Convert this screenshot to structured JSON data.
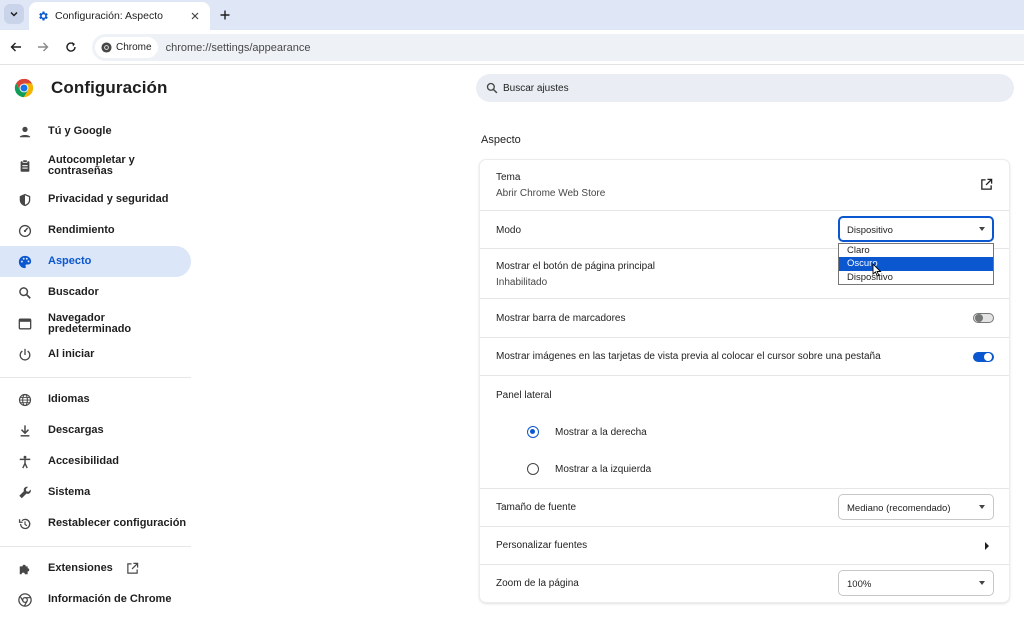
{
  "browser": {
    "tab_title": "Configuración: Aspecto",
    "chip_label": "Chrome",
    "url": "chrome://settings/appearance"
  },
  "sidebar": {
    "title": "Configuración",
    "items": [
      {
        "label": "Tú y Google",
        "icon": "person-icon"
      },
      {
        "label": "Autocompletar y contraseñas",
        "icon": "clipboard-icon"
      },
      {
        "label": "Privacidad y seguridad",
        "icon": "shield-icon"
      },
      {
        "label": "Rendimiento",
        "icon": "speedometer-icon"
      },
      {
        "label": "Aspecto",
        "icon": "palette-icon",
        "active": true
      },
      {
        "label": "Buscador",
        "icon": "search-icon"
      },
      {
        "label": "Navegador predeterminado",
        "icon": "browser-icon"
      },
      {
        "label": "Al iniciar",
        "icon": "power-icon"
      },
      {
        "label": "Idiomas",
        "icon": "globe-icon"
      },
      {
        "label": "Descargas",
        "icon": "download-icon"
      },
      {
        "label": "Accesibilidad",
        "icon": "accessibility-icon"
      },
      {
        "label": "Sistema",
        "icon": "wrench-icon"
      },
      {
        "label": "Restablecer configuración",
        "icon": "restore-icon"
      },
      {
        "label": "Extensiones",
        "icon": "puzzle-icon"
      },
      {
        "label": "Información de Chrome",
        "icon": "chrome-icon"
      }
    ]
  },
  "search": {
    "placeholder": "Buscar ajustes"
  },
  "main": {
    "section_title": "Aspecto",
    "tema": {
      "label": "Tema",
      "sub": "Abrir Chrome Web Store"
    },
    "modo": {
      "label": "Modo",
      "value": "Dispositivo",
      "options": [
        "Claro",
        "Oscuro",
        "Dispositivo"
      ],
      "highlighted": "Oscuro"
    },
    "home_button": {
      "label": "Mostrar el botón de página principal",
      "sub": "Inhabilitado"
    },
    "bookmarks_bar": {
      "label": "Mostrar barra de marcadores",
      "enabled": false
    },
    "tab_previews": {
      "label": "Mostrar imágenes en las tarjetas de vista previa al colocar el cursor sobre una pestaña",
      "enabled": true
    },
    "side_panel": {
      "label": "Panel lateral",
      "right": "Mostrar a la derecha",
      "left": "Mostrar a la izquierda",
      "selected": "right"
    },
    "font_size": {
      "label": "Tamaño de fuente",
      "value": "Mediano (recomendado)"
    },
    "custom_fonts": {
      "label": "Personalizar fuentes"
    },
    "zoom": {
      "label": "Zoom de la página",
      "value": "100%"
    }
  },
  "colors": {
    "accent": "#0b57d0",
    "active_bg": "#dbe6f9",
    "tabstrip": "#dfe7f7"
  }
}
